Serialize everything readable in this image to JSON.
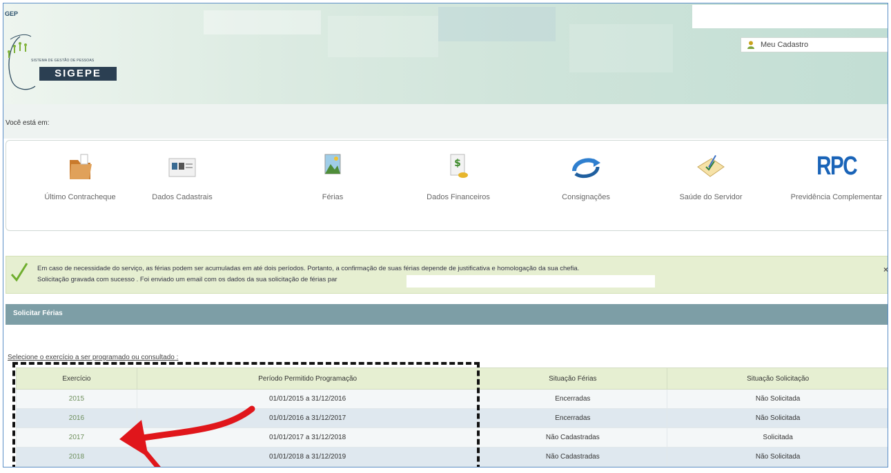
{
  "header": {
    "app_code": "GEP",
    "logo_small": "SISTEMA DE GESTÃO DE PESSOAS",
    "logo_name": "SIGEPE",
    "user_link": "Meu Cadastro"
  },
  "breadcrumb": {
    "label": "Você está em:"
  },
  "shortcuts": [
    {
      "label": "Último Contracheque",
      "icon": "folder-icon"
    },
    {
      "label": "Dados Cadastrais",
      "icon": "id-card-icon"
    },
    {
      "label": "Férias",
      "icon": "landscape-icon"
    },
    {
      "label": "Dados Financeiros",
      "icon": "money-icon"
    },
    {
      "label": "Consignações",
      "icon": "arrow-loop-icon"
    },
    {
      "label": "Saúde do Servidor",
      "icon": "checklist-icon"
    },
    {
      "label": "Previdência Complementar",
      "icon": "rpc-logo",
      "logo_text": "RPC"
    }
  ],
  "message": {
    "line1": "Em caso de necessidade do serviço, as férias podem ser acumuladas em até dois períodos. Portanto, a confirmação de suas férias depende de justificativa e homologação da sua chefia.",
    "line2": "Solicitação gravada com sucesso . Foi enviado um email com os dados da sua solicitação de férias par",
    "close": "×"
  },
  "section": {
    "title": "Solicitar Férias",
    "prompt": "Selecione o exercício a ser programado ou consultado :"
  },
  "table": {
    "headers": [
      "Exercício",
      "Período Permitido Programação",
      "Situação Férias",
      "Situação Solicitação"
    ],
    "rows": [
      [
        "2015",
        "01/01/2015 a 31/12/2016",
        "Encerradas",
        "Não Solicitada"
      ],
      [
        "2016",
        "01/01/2016 a 31/12/2017",
        "Encerradas",
        "Não Solicitada"
      ],
      [
        "2017",
        "01/01/2017 a 31/12/2018",
        "Não Cadastradas",
        "Solicitada"
      ],
      [
        "2018",
        "01/01/2018 a 31/12/2019",
        "Não Cadastradas",
        "Não Solicitada"
      ]
    ]
  },
  "colors": {
    "accent": "#7d9ea6",
    "message_bg": "#e6efd1",
    "annotation_arrow": "#e0161b",
    "rpc": "#1a64b8"
  }
}
